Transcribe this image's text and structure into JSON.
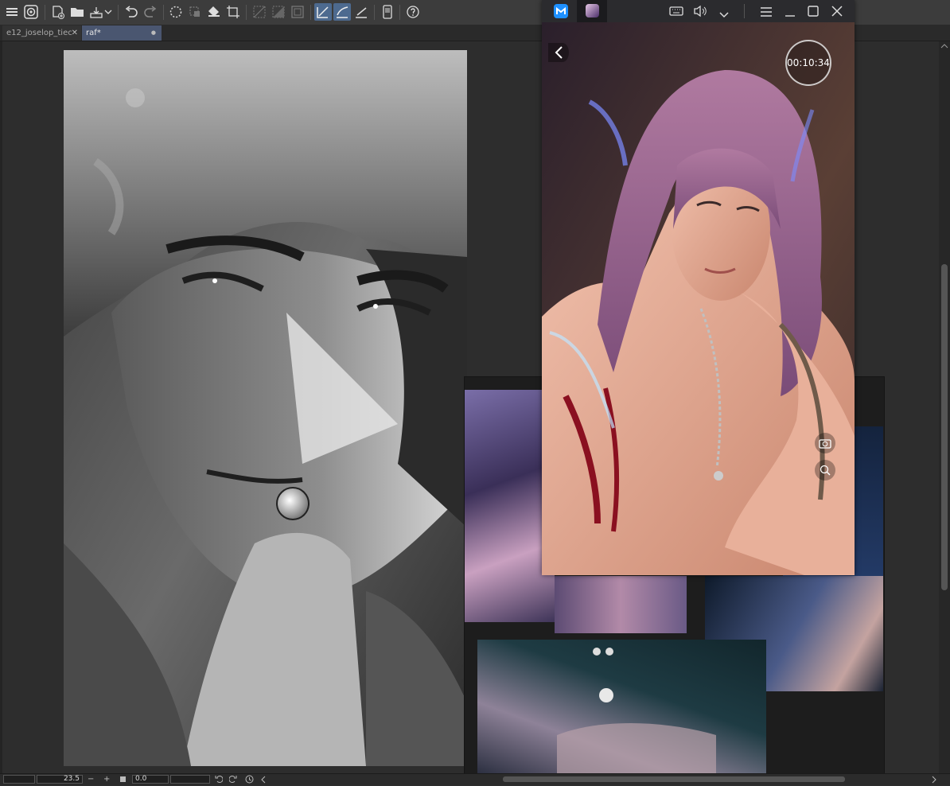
{
  "app": {
    "toolbar_icons": [
      "menu-icon",
      "clip-studio-icon",
      "new-canvas-icon",
      "open-folder-icon",
      "save-icon",
      "dropdown-icon",
      "undo-icon",
      "redo-icon",
      "transform-icon",
      "selection-icon",
      "fill-icon",
      "crop-icon",
      "deselect-icon",
      "invert-selection-icon",
      "border-icon",
      "ruler-snap-icon",
      "special-ruler-icon",
      "perspective-ruler-icon",
      "device-icon",
      "help-icon"
    ]
  },
  "tabs": [
    {
      "label": "e12_joselop_tieс",
      "close": "✕",
      "active": false
    },
    {
      "label": "raf*",
      "close": "●",
      "active": true
    }
  ],
  "phone": {
    "timer": "00:10:34",
    "title_icons": [
      "app-logo-icon",
      "game-tab-icon",
      "keyboard-icon",
      "volume-icon",
      "chevron-down-icon",
      "hamburger-icon",
      "minimize-icon",
      "maximize-icon",
      "close-icon"
    ]
  },
  "statusbar": {
    "zoom": "23.5",
    "minus": "−",
    "plus": "+",
    "rotation": "0.0"
  }
}
